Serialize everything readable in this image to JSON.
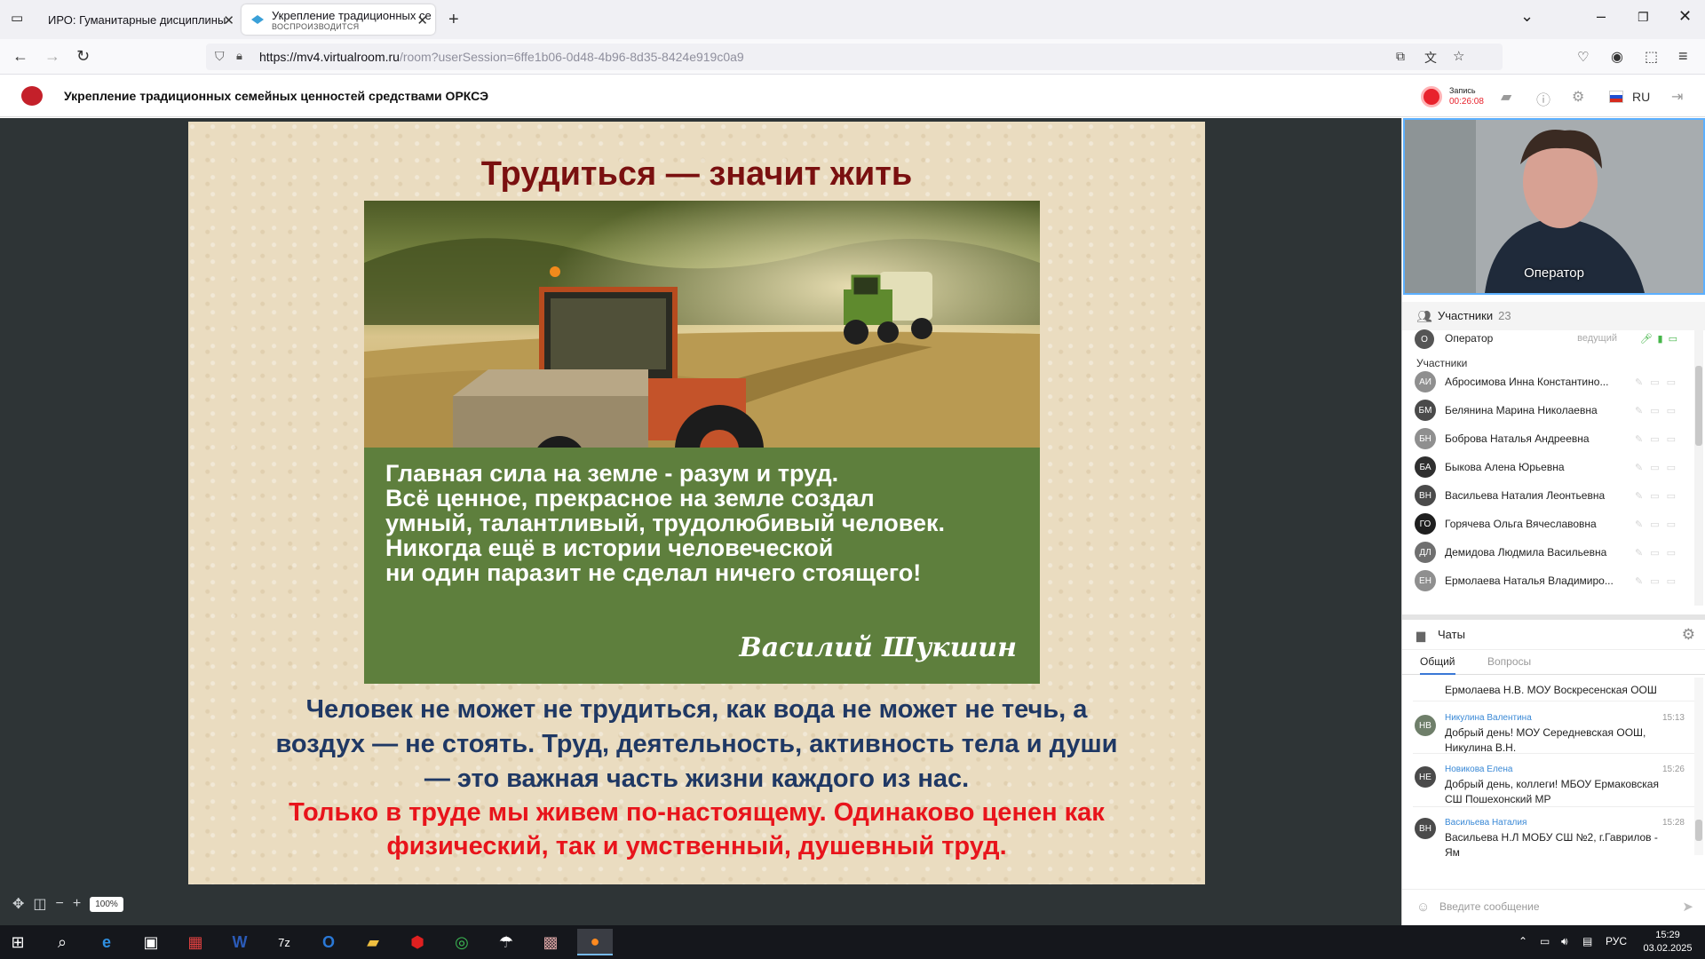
{
  "browser": {
    "tabs": [
      {
        "title": "ИРО: Гуманитарные дисциплины",
        "active": false
      },
      {
        "title": "Укрепление традиционных се",
        "subtitle": "ВОСПРОИЗВОДИТСЯ",
        "active": true
      }
    ],
    "url_host": "https://mv4.virtualroom.ru",
    "url_path": "/room?userSession=6ffe1b06-0d48-4b96-8d35-8424e919c0a9"
  },
  "app": {
    "room_title": "Укрепление традиционных семейных ценностей средствами ОРКСЭ",
    "record_label": "Запись",
    "record_time": "00:26:08",
    "language": "RU",
    "colors": {
      "record": "#e8222c",
      "accent": "#3a78d6"
    }
  },
  "slide": {
    "title": "Трудиться — значит жить",
    "photo_icon": "tractor-field-photo",
    "quote_lines": [
      "Главная сила на земле - разум и труд.",
      "Всё ценное, прекрасное на земле создал",
      "умный, талантливый, трудолюбивый человек.",
      "Никогда ещё в истории человеческой",
      "ни один паразит не сделал ничего стоящего!"
    ],
    "quote_author": "Василий Шукшин",
    "body_lines": [
      "Человек не может не трудиться, как вода не может не течь, а",
      "воздух — не стоять. Труд, деятельность, активность тела и души",
      "— это важная часть жизни каждого из нас."
    ],
    "highlight_lines": [
      "Только в труде мы живем по-настоящему. Одинаково ценен как",
      "физический, так и умственный, душевный труд."
    ],
    "colors": {
      "title": "#7a1010",
      "quote_bg": "#5e7f3d",
      "body": "#1f3864",
      "highlight": "#e8141b"
    }
  },
  "stage": {
    "zoom": "100%"
  },
  "video": {
    "name": "Оператор"
  },
  "participants": {
    "title": "Участники",
    "count": "23",
    "operator": {
      "name": "Оператор",
      "role": "ведущий",
      "initial": "О"
    },
    "section_label": "Участники",
    "list": [
      {
        "initials": "АИ",
        "name": "Абросимова Инна Константино...",
        "color": "#8f8f8f"
      },
      {
        "initials": "БМ",
        "name": "Белянина Марина Николаевна",
        "color": "#4a4a4a"
      },
      {
        "initials": "БН",
        "name": "Боброва Наталья Андреевна",
        "color": "#8f8f8f"
      },
      {
        "initials": "БА",
        "name": "Быкова Алена Юрьевна",
        "color": "#2f2f2f"
      },
      {
        "initials": "ВН",
        "name": "Васильева Наталия Леонтьевна",
        "color": "#4a4a4a"
      },
      {
        "initials": "ГО",
        "name": "Горячева Ольга Вячеславовна",
        "color": "#1f1f1f"
      },
      {
        "initials": "ДЛ",
        "name": "Демидова Людмила Васильевна",
        "color": "#6f6f6f"
      },
      {
        "initials": "ЕН",
        "name": "Ермолаева Наталья Владимиро...",
        "color": "#8f8f8f"
      }
    ]
  },
  "chat": {
    "title": "Чаты",
    "tabs": [
      "Общий",
      "Вопросы"
    ],
    "first_snippet": "Ермолаева Н.В. МОУ Воскресенская ООШ",
    "messages": [
      {
        "initials": "НВ",
        "author": "Никулина Валентина",
        "time": "15:13",
        "text": "Добрый день! МОУ Середневская ООШ, Никулина В.Н.",
        "color": "#6f7f6a"
      },
      {
        "initials": "НЕ",
        "author": "Новикова Елена",
        "time": "15:26",
        "text": "Добрый день, коллеги! МБОУ Ермаковская СШ Пошехонский МР",
        "color": "#4a4a4a"
      },
      {
        "initials": "ВН",
        "author": "Васильева Наталия",
        "time": "15:28",
        "text": "Васильева Н.Л МОБУ СШ №2, г.Гаврилов - Ям",
        "color": "#4a4a4a"
      }
    ],
    "input_placeholder": "Введите сообщение"
  },
  "taskbar": {
    "tray_lang": "РУС",
    "time": "15:29",
    "date": "03.02.2025"
  }
}
